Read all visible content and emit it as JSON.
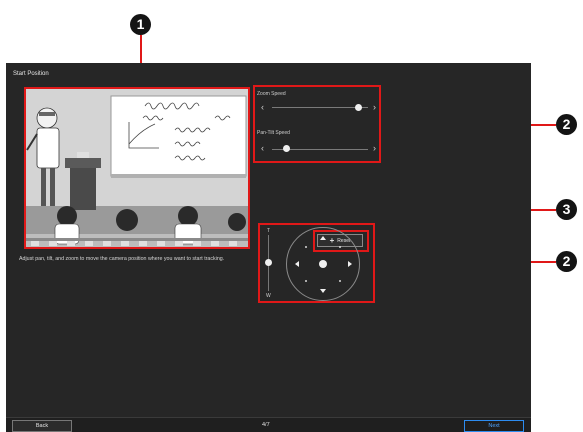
{
  "header": {
    "title": "Start Position"
  },
  "callouts": [
    "1",
    "2",
    "3",
    "2"
  ],
  "speed_panel": {
    "zoom_label": "Zoom Speed",
    "zoom_level": 0.9,
    "pan_tilt_label": "Pan-Tilt Speed",
    "pan_tilt_level": 0.15
  },
  "reset": {
    "label": "Reset"
  },
  "instructions": "Adjust pan, tilt, and zoom to move the camera position where you want to start tracking.",
  "zoom_control": {
    "top_label": "T",
    "bottom_label": "W"
  },
  "footer": {
    "back_label": "Back",
    "page_indicator": "4/7",
    "next_label": "Next"
  },
  "colors": {
    "background": "#262626",
    "annotation_red": "#e01818",
    "next_button": "#2d8cf0"
  }
}
